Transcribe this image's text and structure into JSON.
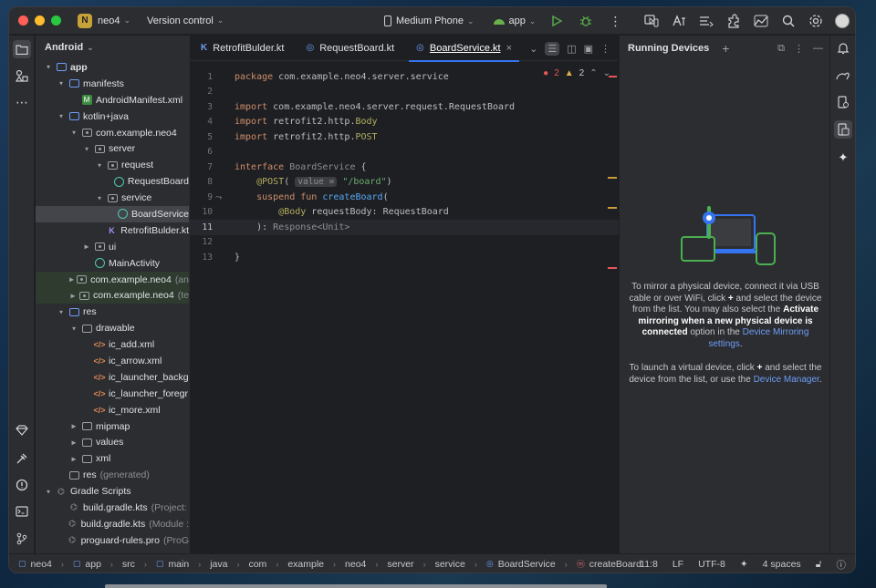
{
  "titlebar": {
    "project_badge": "N",
    "project_name": "neo4",
    "vcs": "Version control",
    "device": "Medium Phone",
    "run_config": "app"
  },
  "project_panel": {
    "title": "Android",
    "tree": [
      {
        "indent": 0,
        "arrow": "down",
        "icon": "folder-blue",
        "label": "app",
        "bold": true
      },
      {
        "indent": 1,
        "arrow": "down",
        "icon": "folder-blue",
        "label": "manifests"
      },
      {
        "indent": 2,
        "arrow": "",
        "icon": "manifest",
        "label": "AndroidManifest.xml"
      },
      {
        "indent": 1,
        "arrow": "down",
        "icon": "folder-blue",
        "label": "kotlin+java"
      },
      {
        "indent": 2,
        "arrow": "down",
        "icon": "package",
        "label": "com.example.neo4"
      },
      {
        "indent": 3,
        "arrow": "down",
        "icon": "package",
        "label": "server"
      },
      {
        "indent": 4,
        "arrow": "down",
        "icon": "package",
        "label": "request"
      },
      {
        "indent": 5,
        "arrow": "",
        "icon": "interface",
        "label": "RequestBoard"
      },
      {
        "indent": 4,
        "arrow": "down",
        "icon": "package",
        "label": "service"
      },
      {
        "indent": 5,
        "arrow": "",
        "icon": "interface",
        "label": "BoardService",
        "selected": true
      },
      {
        "indent": 4,
        "arrow": "",
        "icon": "kotlin",
        "label": "RetrofitBulder.kt"
      },
      {
        "indent": 3,
        "arrow": "right",
        "icon": "package",
        "label": "ui"
      },
      {
        "indent": 3,
        "arrow": "",
        "icon": "interface",
        "label": "MainActivity"
      },
      {
        "indent": 2,
        "arrow": "right",
        "icon": "package",
        "label": "com.example.neo4",
        "suffix": "(an",
        "green": true
      },
      {
        "indent": 2,
        "arrow": "right",
        "icon": "package",
        "label": "com.example.neo4",
        "suffix": "(te",
        "green": true
      },
      {
        "indent": 1,
        "arrow": "down",
        "icon": "folder-blue",
        "label": "res"
      },
      {
        "indent": 2,
        "arrow": "down",
        "icon": "folder",
        "label": "drawable"
      },
      {
        "indent": 3,
        "arrow": "",
        "icon": "xml",
        "label": "ic_add.xml"
      },
      {
        "indent": 3,
        "arrow": "",
        "icon": "xml",
        "label": "ic_arrow.xml"
      },
      {
        "indent": 3,
        "arrow": "",
        "icon": "xml",
        "label": "ic_launcher_backg"
      },
      {
        "indent": 3,
        "arrow": "",
        "icon": "xml",
        "label": "ic_launcher_foregr"
      },
      {
        "indent": 3,
        "arrow": "",
        "icon": "xml",
        "label": "ic_more.xml"
      },
      {
        "indent": 2,
        "arrow": "right",
        "icon": "folder",
        "label": "mipmap"
      },
      {
        "indent": 2,
        "arrow": "right",
        "icon": "folder",
        "label": "values"
      },
      {
        "indent": 2,
        "arrow": "right",
        "icon": "folder",
        "label": "xml"
      },
      {
        "indent": 1,
        "arrow": "",
        "icon": "folder",
        "label": "res",
        "suffix": "(generated)"
      },
      {
        "indent": 0,
        "arrow": "down",
        "icon": "gradle",
        "label": "Gradle Scripts"
      },
      {
        "indent": 1,
        "arrow": "",
        "icon": "gradle",
        "label": "build.gradle.kts",
        "suffix": "(Project:"
      },
      {
        "indent": 1,
        "arrow": "",
        "icon": "gradle",
        "label": "build.gradle.kts",
        "suffix": "(Module :"
      },
      {
        "indent": 1,
        "arrow": "",
        "icon": "gradle",
        "label": "proguard-rules.pro",
        "suffix": "(ProG"
      }
    ]
  },
  "editor": {
    "tabs": [
      {
        "label": "RetrofitBulder.kt",
        "icon": "kotlin",
        "active": false
      },
      {
        "label": "RequestBoard.kt",
        "icon": "interface",
        "active": false
      },
      {
        "label": "BoardService.kt",
        "icon": "interface",
        "active": true
      }
    ],
    "inspections": {
      "errors": "2",
      "warnings": "2"
    },
    "current_line": 11,
    "lines": [
      {
        "n": "1",
        "tokens": [
          [
            "kw",
            "package "
          ],
          [
            "",
            "com.example.neo4.server.service"
          ]
        ]
      },
      {
        "n": "2",
        "tokens": []
      },
      {
        "n": "3",
        "tokens": [
          [
            "kw",
            "import "
          ],
          [
            "",
            "com.example.neo4.server.request.RequestBoard"
          ]
        ]
      },
      {
        "n": "4",
        "tokens": [
          [
            "kw",
            "import "
          ],
          [
            "",
            "retrofit2.http."
          ],
          [
            "ann",
            "Body"
          ]
        ]
      },
      {
        "n": "5",
        "tokens": [
          [
            "kw",
            "import "
          ],
          [
            "",
            "retrofit2.http."
          ],
          [
            "ann",
            "POST"
          ]
        ]
      },
      {
        "n": "6",
        "tokens": []
      },
      {
        "n": "7",
        "tokens": [
          [
            "kw",
            "interface "
          ],
          [
            "dim",
            "BoardService "
          ],
          [
            "",
            "{"
          ]
        ]
      },
      {
        "n": "8",
        "tokens": [
          [
            "",
            "    "
          ],
          [
            "ann",
            "@POST"
          ],
          [
            "",
            "( "
          ],
          [
            "hint",
            "value ="
          ],
          [
            "str",
            " \"/board\""
          ],
          [
            "",
            ")"
          ]
        ]
      },
      {
        "n": "9",
        "tokens": [
          [
            "",
            "    "
          ],
          [
            "kw",
            "suspend fun "
          ],
          [
            "fn",
            "createBoard"
          ],
          [
            "",
            "("
          ]
        ]
      },
      {
        "n": "10",
        "tokens": [
          [
            "",
            "        "
          ],
          [
            "ann",
            "@Body "
          ],
          [
            "",
            "requestBody: RequestBoard"
          ]
        ]
      },
      {
        "n": "11",
        "tokens": [
          [
            "",
            "    ): "
          ],
          [
            "dim",
            "Response<Unit>"
          ]
        ]
      },
      {
        "n": "12",
        "tokens": []
      },
      {
        "n": "13",
        "tokens": [
          [
            "",
            "}"
          ]
        ]
      }
    ]
  },
  "devices": {
    "title": "Running Devices",
    "p1_a": "To mirror a physical device, connect it via USB cable or over WiFi, click",
    "p1_b": "and select the device from the list. You may also select the",
    "p1_bold": "Activate mirroring when a new physical device is connected",
    "p1_c": "option in the",
    "p1_link": "Device Mirroring settings",
    "p1_end": ".",
    "p2_a": "To launch a virtual device, click",
    "p2_b": "and select the device from the list, or use the",
    "p2_link": "Device Manager",
    "p2_end": "."
  },
  "statusbar": {
    "breadcrumbs": [
      "neo4",
      "app",
      "src",
      "main",
      "java",
      "com",
      "example",
      "neo4",
      "server",
      "service",
      "BoardService",
      "createBoard"
    ],
    "position": "11:8",
    "line_sep": "LF",
    "encoding": "UTF-8",
    "indent": "4 spaces"
  },
  "colors": {
    "accent": "#3574f0",
    "error": "#e55757",
    "warning": "#e0b050",
    "badge": "#c7a23a"
  }
}
